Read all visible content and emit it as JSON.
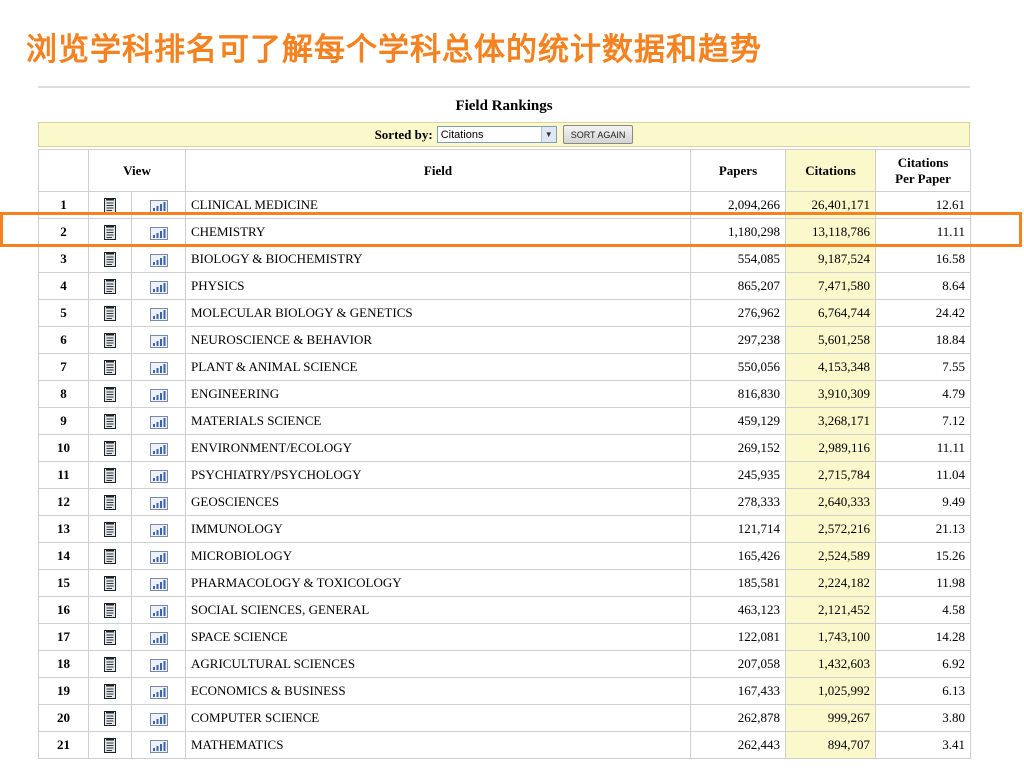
{
  "slide": {
    "title": "浏览学科排名可了解每个学科总体的统计数据和趋势"
  },
  "table": {
    "title": "Field Rankings",
    "sort_label": "Sorted by:",
    "sort_value": "Citations",
    "sort_button": "SORT AGAIN",
    "headers": {
      "view": "View",
      "field": "Field",
      "papers": "Papers",
      "citations": "Citations",
      "cpp_line1": "Citations",
      "cpp_line2": "Per Paper"
    },
    "rows": [
      {
        "rank": "1",
        "field": "CLINICAL MEDICINE",
        "papers": "2,094,266",
        "citations": "26,401,171",
        "cpp": "12.61"
      },
      {
        "rank": "2",
        "field": "CHEMISTRY",
        "papers": "1,180,298",
        "citations": "13,118,786",
        "cpp": "11.11"
      },
      {
        "rank": "3",
        "field": "BIOLOGY & BIOCHEMISTRY",
        "papers": "554,085",
        "citations": "9,187,524",
        "cpp": "16.58"
      },
      {
        "rank": "4",
        "field": "PHYSICS",
        "papers": "865,207",
        "citations": "7,471,580",
        "cpp": "8.64"
      },
      {
        "rank": "5",
        "field": "MOLECULAR BIOLOGY & GENETICS",
        "papers": "276,962",
        "citations": "6,764,744",
        "cpp": "24.42"
      },
      {
        "rank": "6",
        "field": "NEUROSCIENCE & BEHAVIOR",
        "papers": "297,238",
        "citations": "5,601,258",
        "cpp": "18.84"
      },
      {
        "rank": "7",
        "field": "PLANT & ANIMAL SCIENCE",
        "papers": "550,056",
        "citations": "4,153,348",
        "cpp": "7.55"
      },
      {
        "rank": "8",
        "field": "ENGINEERING",
        "papers": "816,830",
        "citations": "3,910,309",
        "cpp": "4.79"
      },
      {
        "rank": "9",
        "field": "MATERIALS SCIENCE",
        "papers": "459,129",
        "citations": "3,268,171",
        "cpp": "7.12"
      },
      {
        "rank": "10",
        "field": "ENVIRONMENT/ECOLOGY",
        "papers": "269,152",
        "citations": "2,989,116",
        "cpp": "11.11"
      },
      {
        "rank": "11",
        "field": "PSYCHIATRY/PSYCHOLOGY",
        "papers": "245,935",
        "citations": "2,715,784",
        "cpp": "11.04"
      },
      {
        "rank": "12",
        "field": "GEOSCIENCES",
        "papers": "278,333",
        "citations": "2,640,333",
        "cpp": "9.49"
      },
      {
        "rank": "13",
        "field": "IMMUNOLOGY",
        "papers": "121,714",
        "citations": "2,572,216",
        "cpp": "21.13"
      },
      {
        "rank": "14",
        "field": "MICROBIOLOGY",
        "papers": "165,426",
        "citations": "2,524,589",
        "cpp": "15.26"
      },
      {
        "rank": "15",
        "field": "PHARMACOLOGY & TOXICOLOGY",
        "papers": "185,581",
        "citations": "2,224,182",
        "cpp": "11.98"
      },
      {
        "rank": "16",
        "field": "SOCIAL SCIENCES, GENERAL",
        "papers": "463,123",
        "citations": "2,121,452",
        "cpp": "4.58"
      },
      {
        "rank": "17",
        "field": "SPACE SCIENCE",
        "papers": "122,081",
        "citations": "1,743,100",
        "cpp": "14.28"
      },
      {
        "rank": "18",
        "field": "AGRICULTURAL SCIENCES",
        "papers": "207,058",
        "citations": "1,432,603",
        "cpp": "6.92"
      },
      {
        "rank": "19",
        "field": "ECONOMICS & BUSINESS",
        "papers": "167,433",
        "citations": "1,025,992",
        "cpp": "6.13"
      },
      {
        "rank": "20",
        "field": "COMPUTER SCIENCE",
        "papers": "262,878",
        "citations": "999,267",
        "cpp": "3.80"
      },
      {
        "rank": "21",
        "field": "MATHEMATICS",
        "papers": "262,443",
        "citations": "894,707",
        "cpp": "3.41"
      }
    ]
  },
  "icons": {
    "document": "document-icon",
    "chart": "bar-chart-icon",
    "dropdown": "chevron-down-icon"
  },
  "colors": {
    "title": "#f58220",
    "highlight": "#f58220",
    "citations_bg": "#fbf8cc"
  }
}
